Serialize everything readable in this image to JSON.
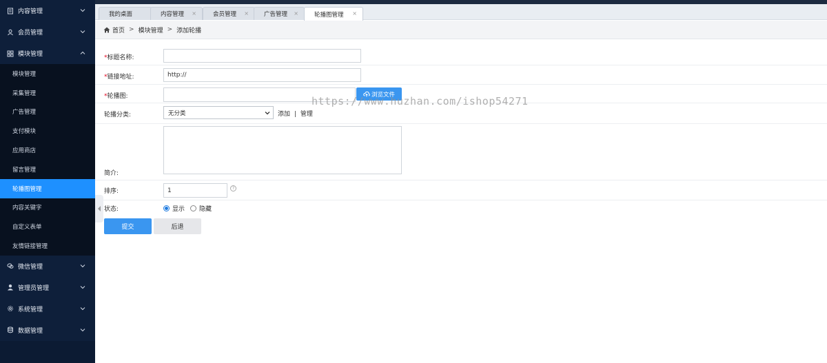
{
  "sidebar": {
    "groups_top": [
      {
        "label": "内容管理",
        "icon": "document-icon"
      },
      {
        "label": "会员管理",
        "icon": "user-icon"
      },
      {
        "label": "模块管理",
        "icon": "grid-icon"
      }
    ],
    "module_items": [
      {
        "label": "模块管理"
      },
      {
        "label": "采集管理"
      },
      {
        "label": "广告管理"
      },
      {
        "label": "支付模块"
      },
      {
        "label": "应用商店"
      },
      {
        "label": "留言管理"
      },
      {
        "label": "轮播图管理"
      },
      {
        "label": "内容关键字"
      },
      {
        "label": "自定义表单"
      },
      {
        "label": "友情链接管理"
      }
    ],
    "groups_bottom": [
      {
        "label": "微信管理",
        "icon": "wechat-icon"
      },
      {
        "label": "管理员管理",
        "icon": "admin-icon"
      },
      {
        "label": "系统管理",
        "icon": "gear-icon"
      },
      {
        "label": "数据管理",
        "icon": "database-icon"
      }
    ]
  },
  "tabs": [
    {
      "label": "我的桌面"
    },
    {
      "label": "内容管理"
    },
    {
      "label": "会员管理"
    },
    {
      "label": "广告管理"
    },
    {
      "label": "轮播图管理"
    }
  ],
  "tab_close": "×",
  "breadcrumb": {
    "home": "首页",
    "level1": "模块管理",
    "level2": "添加轮播",
    "sep": ">"
  },
  "form": {
    "required_mark": "*",
    "title_label": "标题名称:",
    "title_value": "",
    "link_label": "链接地址:",
    "link_value": "http://",
    "image_label": "轮播图:",
    "image_value": "",
    "browse_label": "浏览文件",
    "category_label": "轮播分类:",
    "category_value": "无分类",
    "add_link": "添加",
    "link_divider": "|",
    "manage_link": "管理",
    "intro_label": "简介:",
    "intro_value": "",
    "order_label": "排序:",
    "order_value": "1",
    "help_glyph": "?",
    "status_label": "状态:",
    "status_show": "显示",
    "status_hide": "隐藏",
    "submit_label": "提交",
    "back_label": "后退"
  },
  "watermark": "https://www.huzhan.com/ishop54271",
  "colors": {
    "sidebar_bg": "#0c1b33",
    "accent": "#1e90ff",
    "button": "#3a96f0"
  }
}
